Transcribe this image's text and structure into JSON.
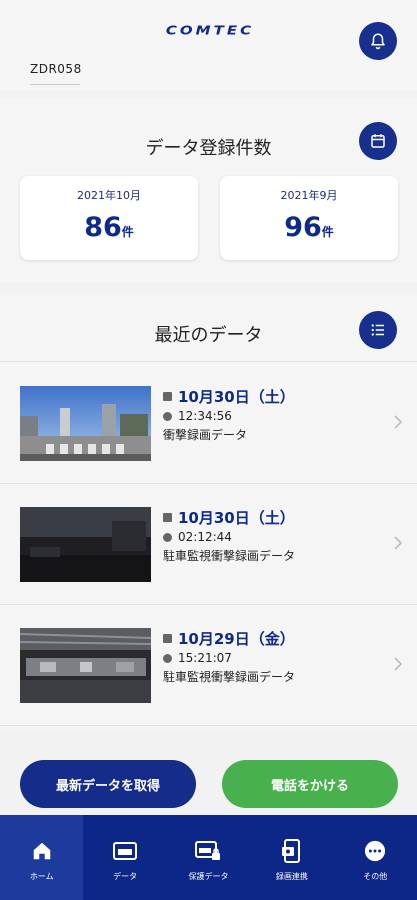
{
  "header": {
    "logo": "COMTEC",
    "device_name": "ZDR058"
  },
  "registration": {
    "title": "データ登録件数",
    "cards": [
      {
        "month": "2021年10月",
        "count": "86",
        "unit": "件"
      },
      {
        "month": "2021年9月",
        "count": "96",
        "unit": "件"
      }
    ]
  },
  "recent": {
    "title": "最近のデータ",
    "items": [
      {
        "date": "10月30日（土）",
        "time": "12:34:56",
        "type": "衝撃録画データ"
      },
      {
        "date": "10月30日（土）",
        "time": "02:12:44",
        "type": "駐車監視衝撃録画データ"
      },
      {
        "date": "10月29日（金）",
        "time": "15:21:07",
        "type": "駐車監視衝撃録画データ"
      }
    ]
  },
  "actions": {
    "get_latest": "最新データを取得",
    "call": "電話をかける"
  },
  "nav": {
    "items": [
      {
        "label": "ホーム",
        "icon": "home-icon",
        "active": true
      },
      {
        "label": "データ",
        "icon": "data-icon",
        "active": false
      },
      {
        "label": "保護データ",
        "icon": "protected-data-icon",
        "active": false
      },
      {
        "label": "録画連携",
        "icon": "recording-link-icon",
        "active": false
      },
      {
        "label": "その他",
        "icon": "more-icon",
        "active": false
      }
    ]
  },
  "colors": {
    "brand": "#17308e",
    "nav_bg": "#0c2787",
    "call_green": "#48b04c"
  }
}
